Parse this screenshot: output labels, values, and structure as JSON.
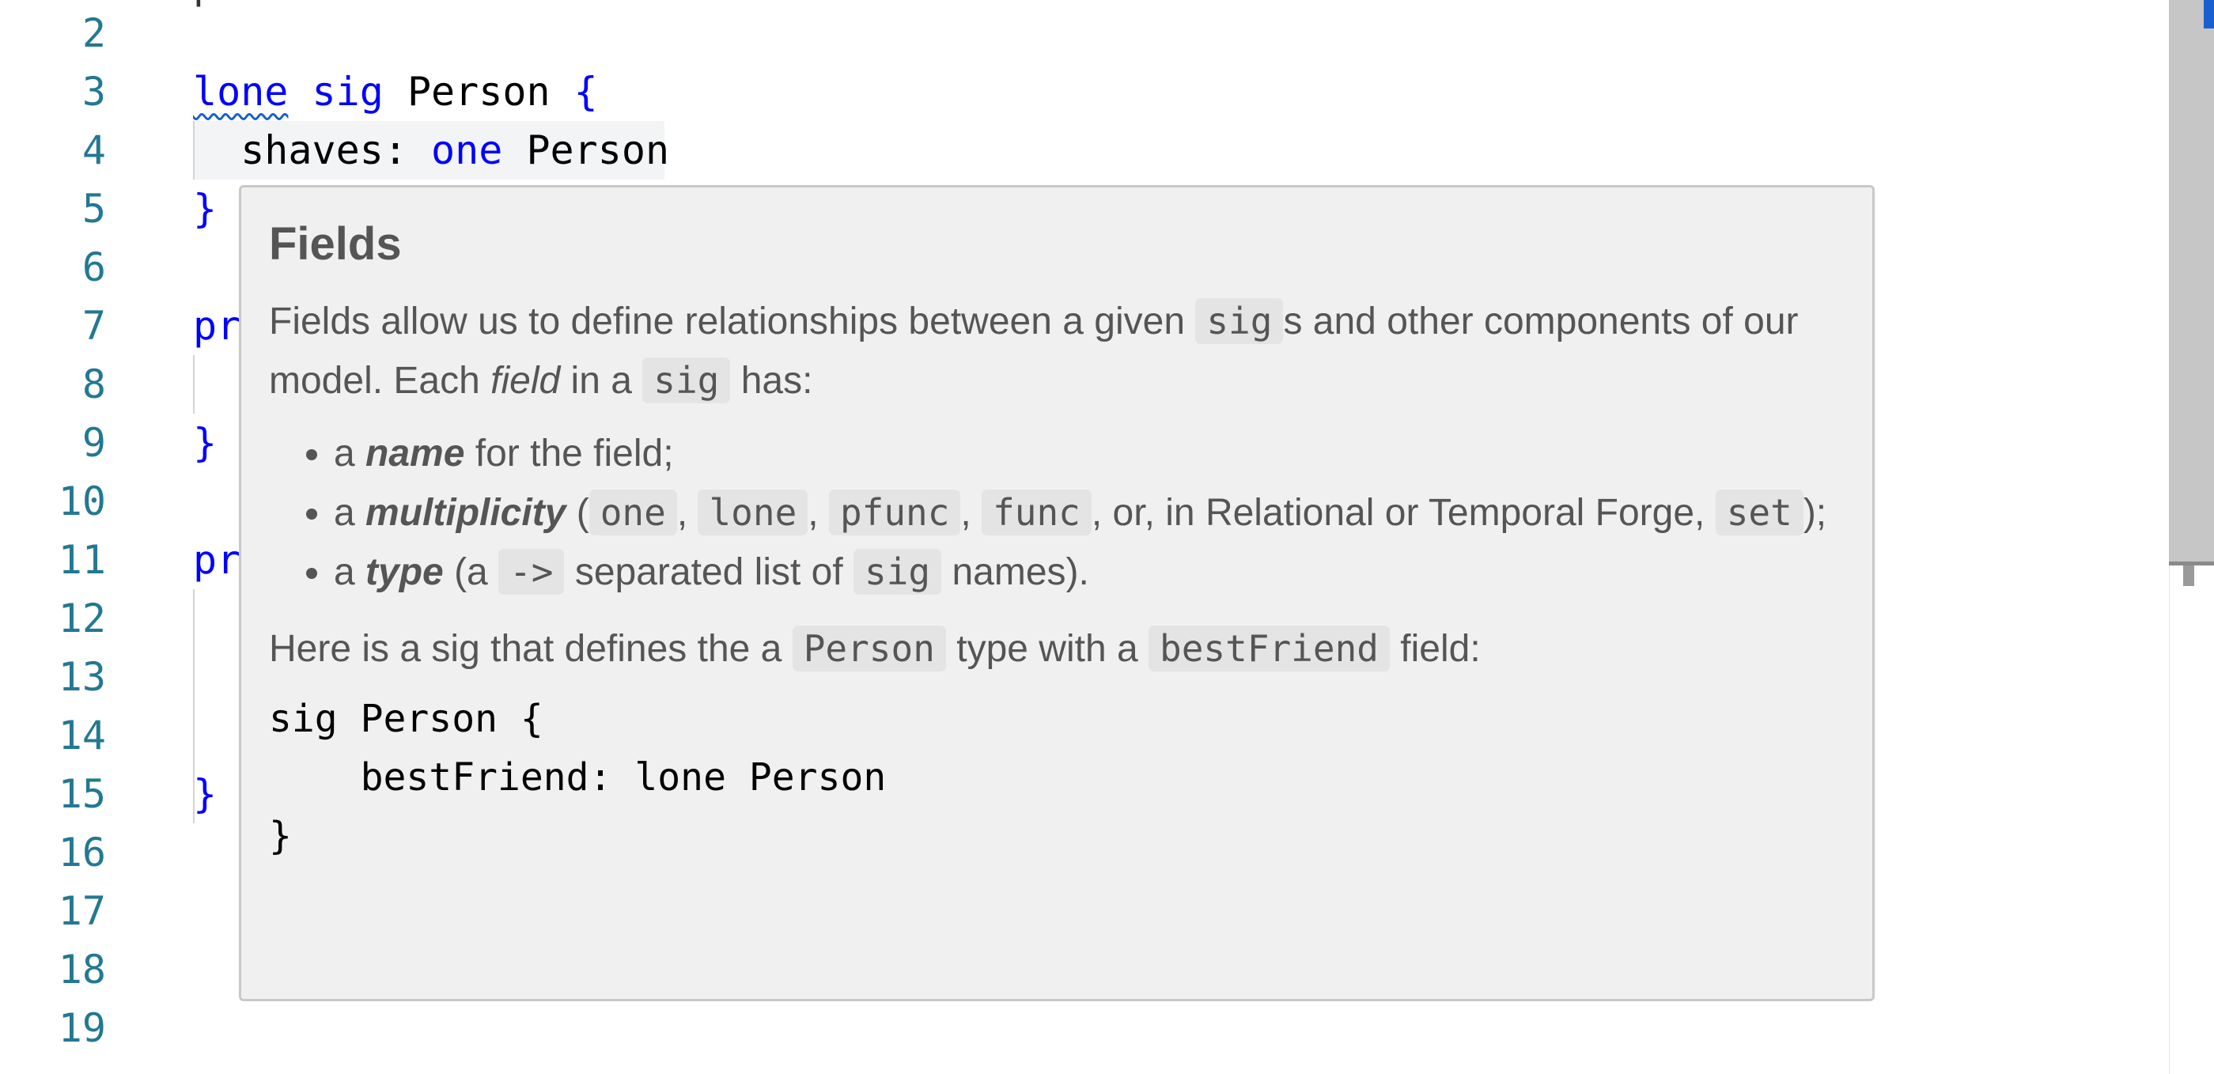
{
  "editor": {
    "top_partial": "pred shaves",
    "lines": [
      {
        "n": "2",
        "tokens": []
      },
      {
        "n": "3",
        "tokens": [
          {
            "t": "lone",
            "k": "kw squiggle"
          },
          {
            "t": " "
          },
          {
            "t": "sig",
            "k": "kw"
          },
          {
            "t": " Person "
          },
          {
            "t": "{",
            "k": "kw"
          }
        ]
      },
      {
        "n": "4",
        "tokens": [
          {
            "t": "  shaves: "
          },
          {
            "t": "one",
            "k": "kw"
          },
          {
            "t": " Person"
          }
        ]
      },
      {
        "n": "5",
        "tokens": [
          {
            "t": "}",
            "k": "kw"
          }
        ]
      },
      {
        "n": "6",
        "tokens": []
      },
      {
        "n": "7",
        "tokens": [
          {
            "t": "pr",
            "k": "kw"
          }
        ]
      },
      {
        "n": "8",
        "tokens": []
      },
      {
        "n": "9",
        "tokens": [
          {
            "t": "}",
            "k": "kw"
          }
        ]
      },
      {
        "n": "10",
        "tokens": []
      },
      {
        "n": "11",
        "tokens": [
          {
            "t": "pr",
            "k": "kw"
          }
        ]
      },
      {
        "n": "12",
        "tokens": []
      },
      {
        "n": "13",
        "tokens": []
      },
      {
        "n": "14",
        "tokens": []
      },
      {
        "n": "15",
        "tokens": [
          {
            "t": "}",
            "k": "kw"
          }
        ]
      },
      {
        "n": "16",
        "tokens": []
      },
      {
        "n": "17",
        "tokens": []
      },
      {
        "n": "18",
        "tokens": []
      },
      {
        "n": "19",
        "tokens": []
      }
    ]
  },
  "hover": {
    "title": "Fields",
    "intro": {
      "a": "Fields allow us to define relationships between a given ",
      "code1": "sig",
      "b": "s and other components of our model. Each ",
      "em": "field",
      "c": " in a ",
      "code2": "sig",
      "d": " has:"
    },
    "bullet1": {
      "a": "a ",
      "strong": "name",
      "b": " for the field;"
    },
    "bullet2": {
      "a": "a ",
      "strong": "multiplicity",
      "b": " (",
      "c1": "one",
      "c2": "lone",
      "c3": "pfunc",
      "c4": "func",
      "sep": ", ",
      "c": ", or, in Relational or Temporal Forge, ",
      "c5": "set",
      "d": ");"
    },
    "bullet3": {
      "a": "a ",
      "strong": "type",
      "b": " (a ",
      "code": "->",
      "c": " separated list of ",
      "code2": "sig",
      "d": " names)."
    },
    "example_intro": {
      "a": "Here is a sig that defines the a ",
      "code1": "Person",
      "b": " type with a ",
      "code2": "bestFriend",
      "c": " field:"
    },
    "example_code": "sig Person {\n    bestFriend: lone Person\n}"
  },
  "colors": {
    "keyword": "#0000ff",
    "line_number": "#237893",
    "popup_bg": "#f0f0f0",
    "scroll_marker": "#1a5fd0"
  }
}
